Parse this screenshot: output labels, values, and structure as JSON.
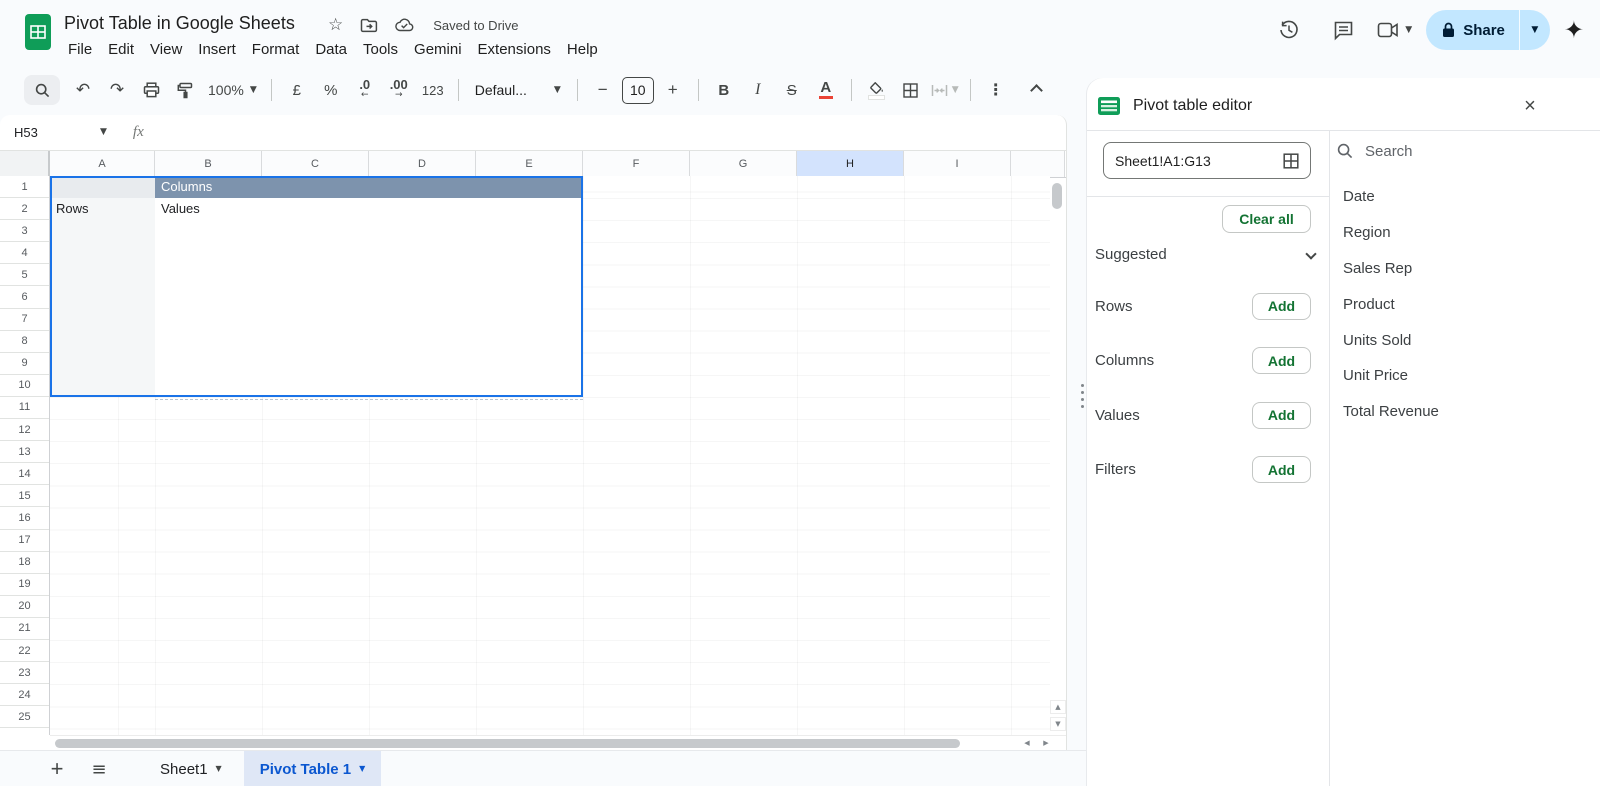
{
  "colors": {
    "app_background": "#f9fbfd",
    "selection_blue": "#1a73e8",
    "pivot_header_slate": "#7d93ad",
    "column_highlight": "#d3e3fd",
    "share_button_bg": "#c2e7ff",
    "share_button_text": "#001d35",
    "green_action_text": "#137333",
    "sheets_logo_green": "#0f9d58",
    "active_tab_bg": "#dfe7f6",
    "active_tab_text": "#0b57d0"
  },
  "header": {
    "title": "Pivot Table in Google Sheets",
    "saved_status": "Saved to Drive",
    "menus": [
      "File",
      "Edit",
      "View",
      "Insert",
      "Format",
      "Data",
      "Tools",
      "Gemini",
      "Extensions",
      "Help"
    ]
  },
  "top_right": {
    "share_label": "Share"
  },
  "toolbar": {
    "zoom": "100%",
    "currency": "£",
    "percent": "%",
    "decimal_decrease": ".0",
    "decimal_increase": ".00",
    "more_formats": "123",
    "font_name": "Defaul...",
    "font_size": "10",
    "bold": "B",
    "italic": "I",
    "strikethrough": "S",
    "text_color": "A"
  },
  "formula_bar": {
    "cell_reference": "H53",
    "fx_label": "fx"
  },
  "grid": {
    "columns": [
      "A",
      "B",
      "C",
      "D",
      "E",
      "F",
      "G",
      "H",
      "I"
    ],
    "highlighted_column": "H",
    "row_numbers": [
      "1",
      "2",
      "3",
      "4",
      "5",
      "6",
      "7",
      "8",
      "9",
      "10",
      "11",
      "12",
      "13",
      "14",
      "15",
      "16",
      "17",
      "18",
      "19",
      "20",
      "21",
      "22",
      "23",
      "24",
      "25"
    ],
    "pivot_table": {
      "columns_label": "Columns",
      "rows_label": "Rows",
      "values_label": "Values"
    }
  },
  "sheet_tabs": {
    "sheet1_label": "Sheet1",
    "active_tab_label": "Pivot Table 1"
  },
  "panel": {
    "title": "Pivot table editor",
    "range": "Sheet1!A1:G13",
    "search_placeholder": "Search",
    "clear_all_label": "Clear all",
    "suggested_label": "Suggested",
    "add_label": "Add",
    "sections": [
      "Rows",
      "Columns",
      "Values",
      "Filters"
    ],
    "fields": [
      "Date",
      "Region",
      "Sales Rep",
      "Product",
      "Units Sold",
      "Unit Price",
      "Total Revenue"
    ]
  }
}
